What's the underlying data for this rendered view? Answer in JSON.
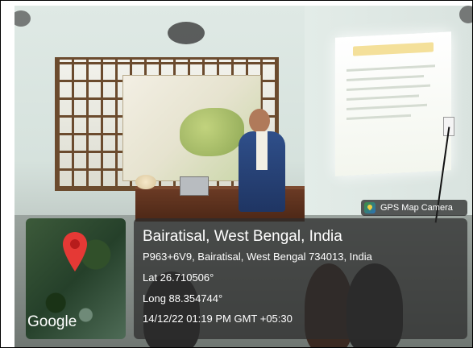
{
  "overlay": {
    "app_label": "GPS Map Camera",
    "map_logo_text": "Google",
    "location_title": "Bairatisal, West Bengal, India",
    "address": "P963+6V9, Bairatisal, West Bengal 734013, India",
    "latitude": "Lat 26.710506°",
    "longitude": "Long 88.354744°",
    "timestamp": "14/12/22 01:19 PM GMT +05:30"
  },
  "icons": {
    "app_icon": "gps-map-camera-icon",
    "map_pin": "map-pin-icon"
  },
  "colors": {
    "pin": "#e53935",
    "overlay_bg": "#2d2d2d",
    "overlay_text": "#ffffff"
  }
}
